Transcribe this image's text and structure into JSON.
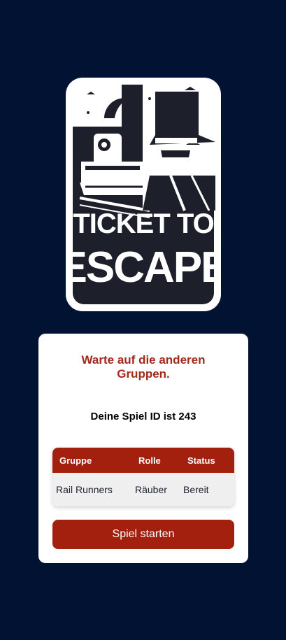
{
  "logo": {
    "line1": "TICKET TO",
    "line2": "ESCAPE"
  },
  "card": {
    "wait_line1": "Warte auf die anderen",
    "wait_line2": "Gruppen.",
    "game_id_text": "Deine Spiel ID ist 243",
    "table": {
      "headers": [
        "Gruppe",
        "Rolle",
        "Status"
      ],
      "rows": [
        [
          "Rail Runners",
          "Räuber",
          "Bereit"
        ]
      ]
    },
    "start_button_label": "Spiel starten"
  },
  "colors": {
    "background": "#021233",
    "accent": "#a2200d",
    "title_red": "#a22a1b",
    "logo_dark": "#1d1f2b"
  }
}
